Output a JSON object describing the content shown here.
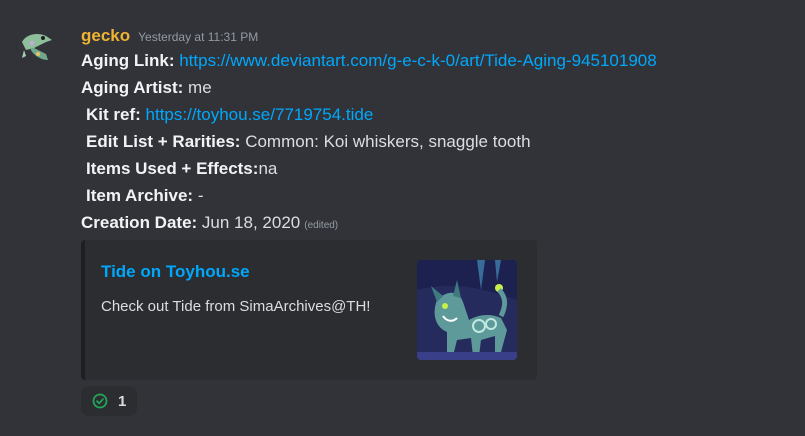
{
  "message": {
    "username": "gecko",
    "timestamp": "Yesterday at 11:31 PM",
    "avatar_icon": "gecko-avatar-icon",
    "fields": {
      "aging_link": {
        "label": "Aging Link:",
        "value": "https://www.deviantart.com/g-e-c-k-0/art/Tide-Aging-945101908"
      },
      "aging_artist": {
        "label": "Aging Artist:",
        "value": "me"
      },
      "kit_ref": {
        "label": "Kit ref:",
        "value": "https://toyhou.se/7719754.tide"
      },
      "edit_list": {
        "label": "Edit List + Rarities:",
        "value": "Common: Koi whiskers, snaggle tooth"
      },
      "items_used": {
        "label": "Items Used + Effects:",
        "value": "na"
      },
      "item_archive": {
        "label": "Item Archive:",
        "value": "-"
      },
      "creation_date": {
        "label": "Creation Date:",
        "value": "Jun 18, 2020",
        "edited": "(edited)"
      }
    }
  },
  "embed": {
    "title": "Tide on Toyhou.se",
    "description": "Check out Tide from SimaArchives@TH!",
    "thumbnail_icon": "character-thumbnail"
  },
  "reaction": {
    "icon": "check-circle-icon",
    "count": "1",
    "color": "#23a55a"
  }
}
